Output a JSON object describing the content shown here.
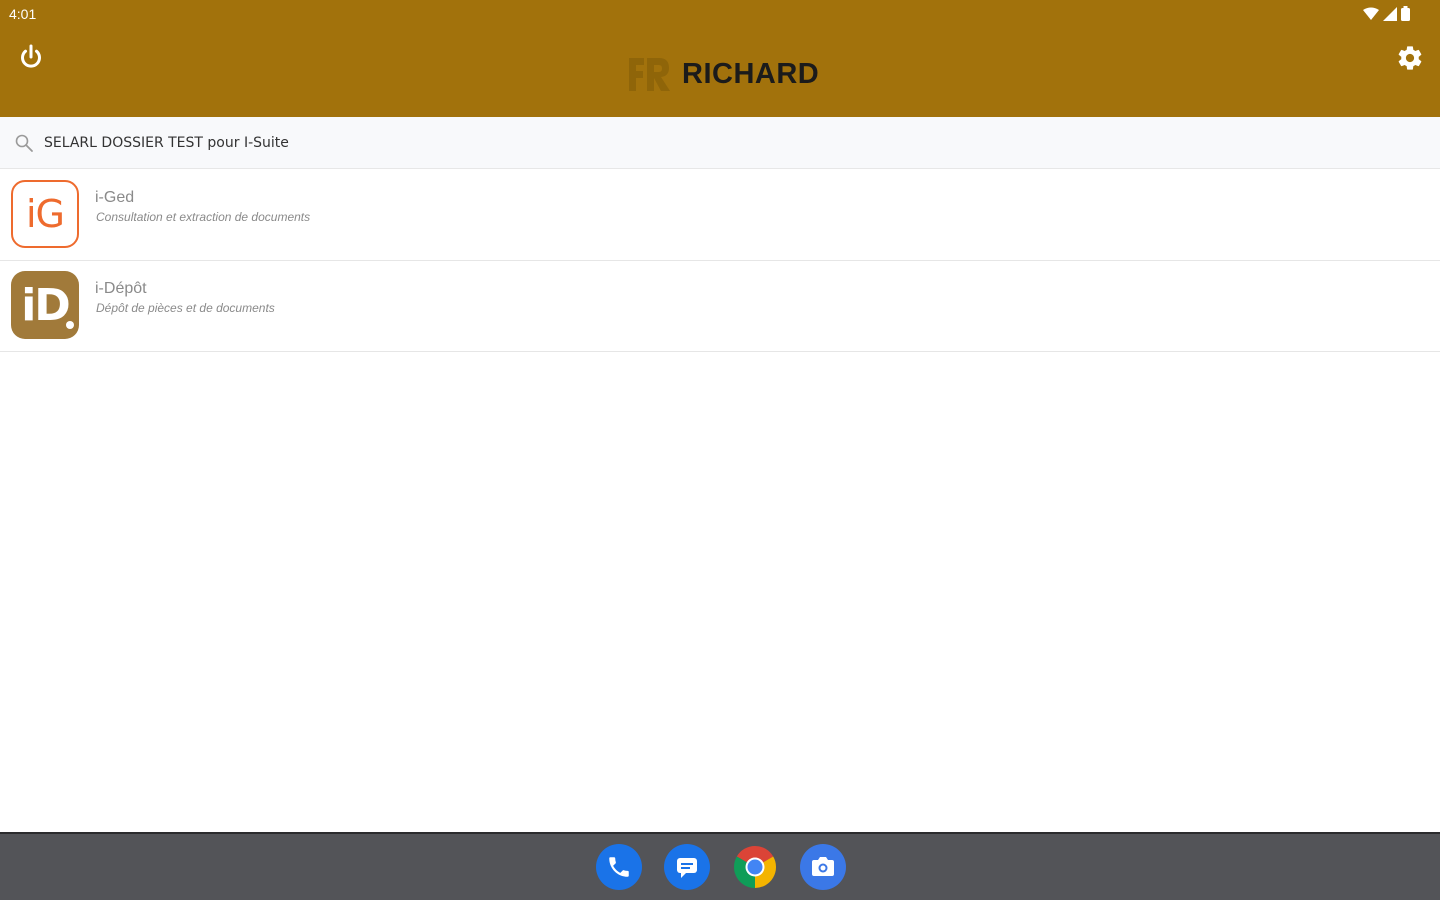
{
  "status": {
    "time": "4:01"
  },
  "header": {
    "brand": "RICHARD"
  },
  "search": {
    "value": "SELARL DOSSIER TEST pour I-Suite"
  },
  "apps": [
    {
      "title": "i-Ged",
      "subtitle": "Consultation et extraction de documents",
      "icon_text": "iG",
      "icon_color": "#ee6b2e"
    },
    {
      "title": "i-Dépôt",
      "subtitle": "Dépôt de pièces et de documents",
      "icon_text": "iD",
      "icon_color": "#a17a3a"
    }
  ],
  "colors": {
    "appbar": "#a2720c",
    "navbar": "#535458"
  },
  "dock": [
    "phone-icon",
    "messages-icon",
    "chrome-icon",
    "camera-icon"
  ]
}
